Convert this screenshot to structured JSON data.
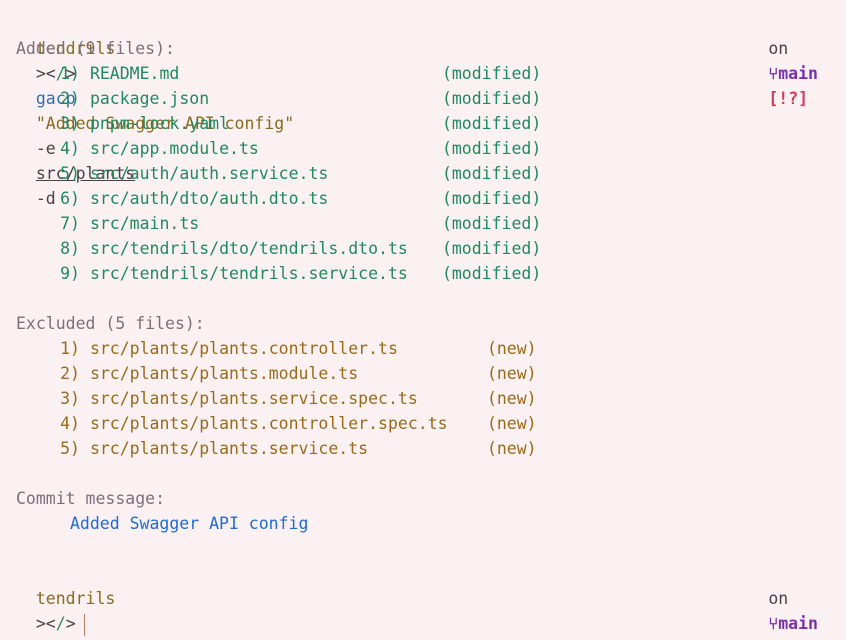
{
  "prompt": {
    "dir": "tendrils",
    "symbol_open": "><",
    "symbol_slash": "/",
    "symbol_close": ">",
    "on": "on",
    "branch_icon": "git-branch-icon",
    "branch": "main",
    "status": "[!?]"
  },
  "command": {
    "name": "gacp",
    "message": "\"Added Swagger API config\"",
    "flag_e": "-e",
    "path": "src/plants",
    "flag_d": "-d"
  },
  "added": {
    "heading": "Added (9 files):",
    "items": [
      {
        "idx": "1)",
        "file": "README.md",
        "status": "(modified)"
      },
      {
        "idx": "2)",
        "file": "package.json",
        "status": "(modified)"
      },
      {
        "idx": "3)",
        "file": "pnpm-lock.yaml",
        "status": "(modified)"
      },
      {
        "idx": "4)",
        "file": "src/app.module.ts",
        "status": "(modified)"
      },
      {
        "idx": "5)",
        "file": "src/auth/auth.service.ts",
        "status": "(modified)"
      },
      {
        "idx": "6)",
        "file": "src/auth/dto/auth.dto.ts",
        "status": "(modified)"
      },
      {
        "idx": "7)",
        "file": "src/main.ts",
        "status": "(modified)"
      },
      {
        "idx": "8)",
        "file": "src/tendrils/dto/tendrils.dto.ts",
        "status": "(modified)"
      },
      {
        "idx": "9)",
        "file": "src/tendrils/tendrils.service.ts",
        "status": "(modified)"
      }
    ]
  },
  "excluded": {
    "heading": "Excluded (5 files):",
    "items": [
      {
        "idx": "1)",
        "file": "src/plants/plants.controller.ts",
        "status": "(new)"
      },
      {
        "idx": "2)",
        "file": "src/plants/plants.module.ts",
        "status": "(new)"
      },
      {
        "idx": "3)",
        "file": "src/plants/plants.service.spec.ts",
        "status": "(new)"
      },
      {
        "idx": "4)",
        "file": "src/plants/plants.controller.spec.ts",
        "status": "(new)"
      },
      {
        "idx": "5)",
        "file": "src/plants/plants.service.ts",
        "status": "(new)"
      }
    ]
  },
  "commit": {
    "heading": "Commit message:",
    "message": "Added Swagger API config"
  }
}
